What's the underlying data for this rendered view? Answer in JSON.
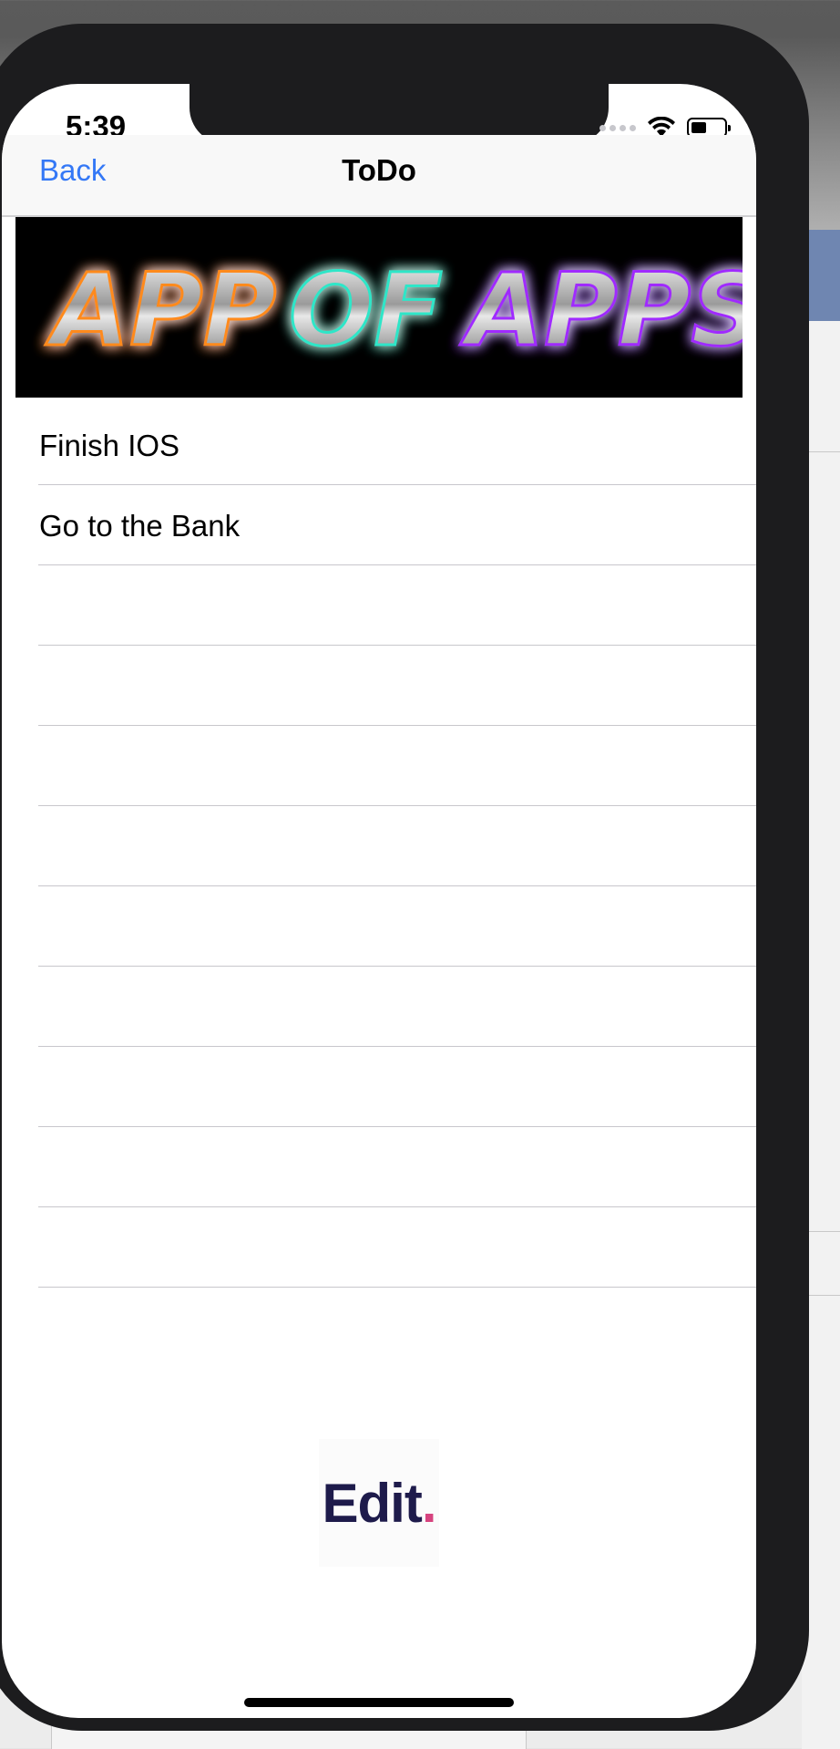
{
  "status_bar": {
    "time": "5:39",
    "icons": [
      "signal-icon",
      "wifi-icon",
      "battery-icon"
    ]
  },
  "nav": {
    "back_label": "Back",
    "title": "ToDo",
    "accent_color": "#3478f6"
  },
  "banner": {
    "text": "APP OF APPS",
    "words": [
      "APP",
      "OF",
      "APPS"
    ],
    "glow_colors": [
      "#ff6a00",
      "#9aff00",
      "#00e0ff",
      "#4d5bff",
      "#d21bff"
    ]
  },
  "todo": {
    "items": [
      "Finish IOS",
      "Go to the Bank",
      "",
      "",
      "",
      "",
      "",
      "",
      "",
      "",
      ""
    ]
  },
  "footer_logo": {
    "text": "Edit",
    "dot": ".",
    "text_color": "#1e1b4b",
    "dot_color": "#d6447f"
  }
}
